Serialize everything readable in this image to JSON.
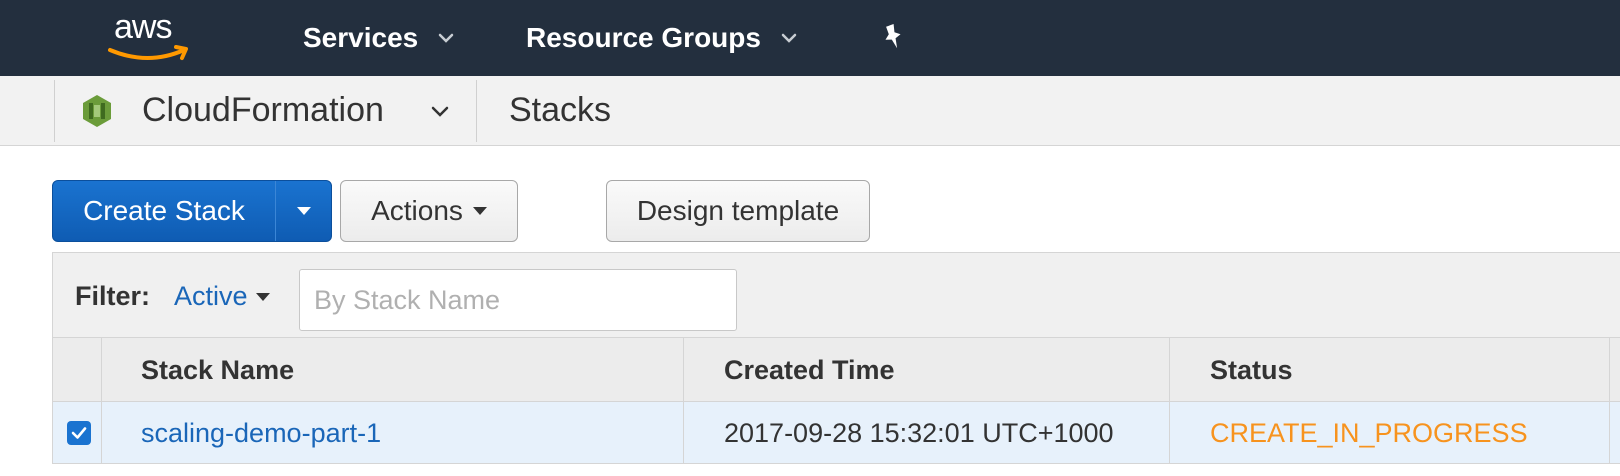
{
  "topnav": {
    "logo_text": "aws",
    "services_label": "Services",
    "resource_groups_label": "Resource Groups",
    "pin_icon": "pin-icon"
  },
  "subnav": {
    "service_name": "CloudFormation",
    "page_name": "Stacks"
  },
  "toolbar": {
    "create_stack_label": "Create Stack",
    "actions_label": "Actions",
    "design_template_label": "Design template"
  },
  "filter": {
    "label": "Filter:",
    "value": "Active",
    "search_placeholder": "By Stack Name",
    "search_value": ""
  },
  "table": {
    "columns": [
      "Stack Name",
      "Created Time",
      "Status"
    ],
    "rows": [
      {
        "selected": true,
        "stack_name": "scaling-demo-part-1",
        "created_time": "2017-09-28 15:32:01 UTC+1000",
        "status": "CREATE_IN_PROGRESS"
      }
    ]
  },
  "colors": {
    "nav_bg": "#232f3e",
    "primary": "#1a73d0",
    "link": "#1a66b8",
    "status_in_progress": "#f7931e",
    "selected_row": "#e7f1fb"
  }
}
